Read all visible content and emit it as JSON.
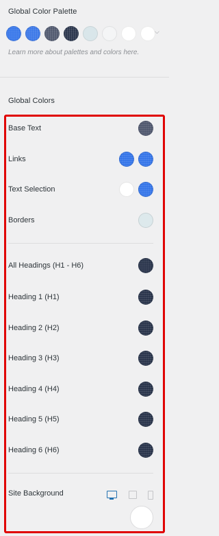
{
  "palette": {
    "title": "Global Color Palette",
    "hint": "Learn more about palettes and colors here.",
    "swatches": [
      {
        "name": "bright-blue",
        "color": "#2b6ee8"
      },
      {
        "name": "blue",
        "color": "#2f6fe6"
      },
      {
        "name": "slate",
        "color": "#475066"
      },
      {
        "name": "navy",
        "color": "#1f2b43"
      },
      {
        "name": "light-teal",
        "color": "#d9e6ea"
      },
      {
        "name": "off-white",
        "color": "#f4f5f6"
      },
      {
        "name": "white",
        "color": "#ffffff"
      },
      {
        "name": "white-2",
        "color": "#ffffff"
      }
    ]
  },
  "global_colors": {
    "title": "Global Colors",
    "rows": [
      {
        "label": "Base Text",
        "colors": [
          "#485068"
        ]
      },
      {
        "label": "Links",
        "colors": [
          "#2c6fe8",
          "#2c6fe8"
        ]
      },
      {
        "label": "Text Selection",
        "colors": [
          "#ffffff",
          "#2c6fe8"
        ]
      },
      {
        "label": "Borders",
        "colors": [
          "#dde9ec"
        ]
      },
      {
        "label": "All Headings (H1 - H6)",
        "colors": [
          "#1f2b43"
        ]
      },
      {
        "label": "Heading 1 (H1)",
        "colors": [
          "#1f2b43"
        ]
      },
      {
        "label": "Heading 2 (H2)",
        "colors": [
          "#1f2b43"
        ]
      },
      {
        "label": "Heading 3 (H3)",
        "colors": [
          "#1f2b43"
        ]
      },
      {
        "label": "Heading 4 (H4)",
        "colors": [
          "#1f2b43"
        ]
      },
      {
        "label": "Heading 5 (H5)",
        "colors": [
          "#1f2b43"
        ]
      },
      {
        "label": "Heading 6 (H6)",
        "colors": [
          "#1f2b43"
        ]
      }
    ],
    "site_background": {
      "label": "Site Background",
      "devices": [
        "desktop-icon",
        "tablet-icon",
        "mobile-icon"
      ],
      "active_device": "desktop",
      "color": "#ffffff"
    }
  },
  "colors": {
    "highlight_border": "#e00000",
    "active_device": "#2271b1"
  }
}
